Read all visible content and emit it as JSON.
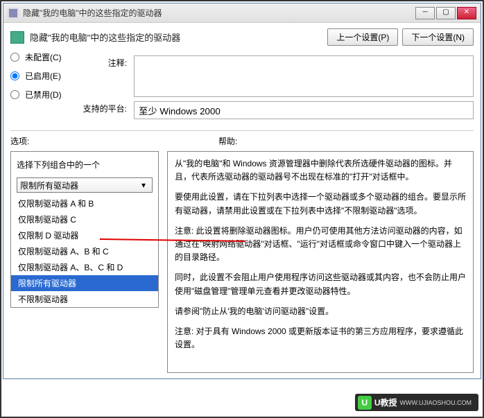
{
  "title": "隐藏\"我的电脑\"中的这些指定的驱动器",
  "heading": "隐藏\"我的电脑\"中的这些指定的驱动器",
  "nav": {
    "prev": "上一个设置(P)",
    "next": "下一个设置(N)"
  },
  "status": {
    "not_configured": "未配置(C)",
    "enabled": "已启用(E)",
    "disabled": "已禁用(D)"
  },
  "labels": {
    "comment": "注释:",
    "supported_on": "支持的平台:",
    "options": "选项:",
    "help": "帮助:"
  },
  "supported_value": "至少 Windows 2000",
  "left": {
    "caption": "选择下列组合中的一个",
    "combo_value": "限制所有驱动器",
    "options": [
      "仅限制驱动器 A 和 B",
      "仅限制驱动器 C",
      "仅限制 D 驱动器",
      "仅限制驱动器 A、B 和 C",
      "仅限制驱动器 A、B、C 和 D",
      "限制所有驱动器",
      "不限制驱动器"
    ]
  },
  "help_text": {
    "p1": "从\"我的电脑\"和 Windows 资源管理器中删除代表所选硬件驱动器的图标。并且，代表所选驱动器的驱动器号不出现在标准的\"打开\"对话框中。",
    "p2": "要使用此设置，请在下拉列表中选择一个驱动器或多个驱动器的组合。要显示所有驱动器，请禁用此设置或在下拉列表中选择\"不限制驱动器\"选项。",
    "p3": "注意: 此设置将删除驱动器图标。用户仍可使用其他方法访问驱动器的内容，如通过在\"映射网络驱动器\"对话框、\"运行\"对话框或命令窗口中键入一个驱动器上的目录路径。",
    "p4": "同时，此设置不会阻止用户使用程序访问这些驱动器或其内容，也不会防止用户使用\"磁盘管理\"管理单元查看并更改驱动器特性。",
    "p5": "请参阅\"防止从'我的电脑'访问驱动器\"设置。",
    "p6": "注意: 对于具有 Windows 2000 或更新版本证书的第三方应用程序，要求遵循此设置。"
  },
  "watermark": {
    "big": "U教授",
    "sub": "WWW.UJIAOSHOU.COM"
  }
}
